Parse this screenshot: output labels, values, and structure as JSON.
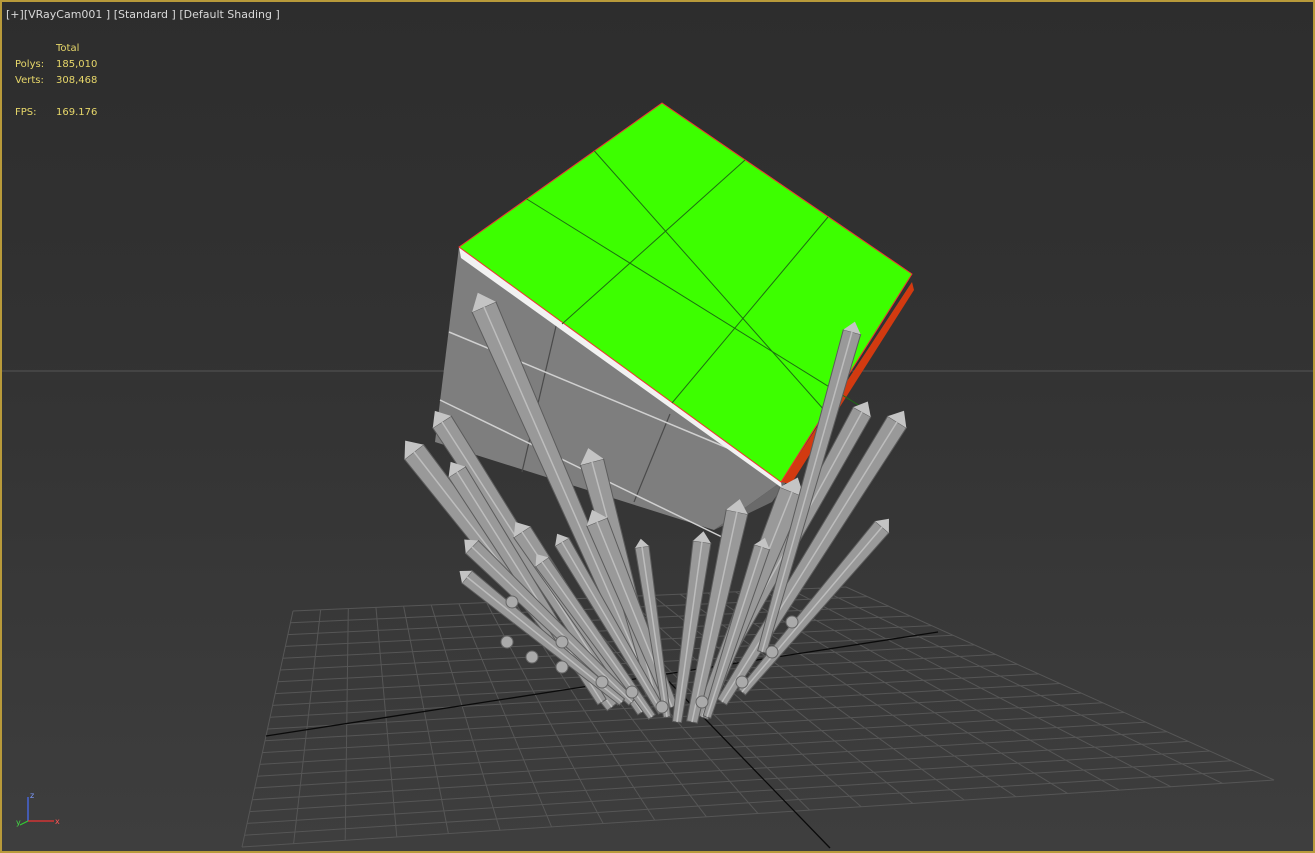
{
  "viewport": {
    "label": {
      "plus": "[+]",
      "camera": "[VRayCam001 ]",
      "mode": "[Standard ]",
      "shading": "[Default Shading ]"
    },
    "stats": {
      "header": "Total",
      "polys_label": "Polys:",
      "polys_value": "185,010",
      "verts_label": "Verts:",
      "verts_value": "308,468",
      "fps_label": "FPS:",
      "fps_value": "169.176"
    },
    "axis": {
      "z": "z",
      "y": "y",
      "x": "x"
    },
    "colors": {
      "border": "#b89a3a",
      "stats_text": "#e7d76a",
      "selected_face": "#3dff00",
      "mesh_gray": "#8f8f8f",
      "grid_line": "#4d4d4d"
    }
  }
}
